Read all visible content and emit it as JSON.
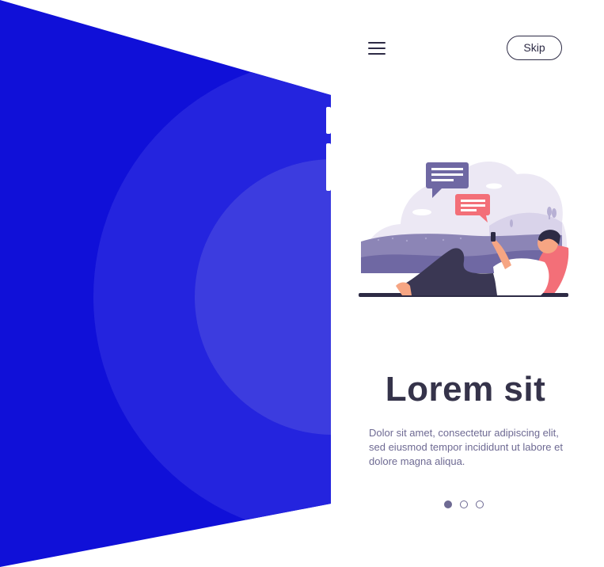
{
  "header": {
    "menu_icon": "hamburger-menu-icon",
    "skip_label": "Skip"
  },
  "illustration": {
    "description_icon": "man-relaxing-with-phone-illustration"
  },
  "content": {
    "title": "Lorem sit",
    "body": "Dolor sit amet, consectetur adipiscing elit, sed eiusmod tempor incididunt ut labore et dolore magna aliqua."
  },
  "pagination": {
    "total": 3,
    "active_index": 0
  },
  "colors": {
    "blue_dark": "#1010d8",
    "blue_mid": "#2a2ae0",
    "blue_light": "#3e3ee0",
    "text_dark": "#35334a",
    "text_muted": "#6e6a93",
    "accent_red": "#f36f78"
  }
}
